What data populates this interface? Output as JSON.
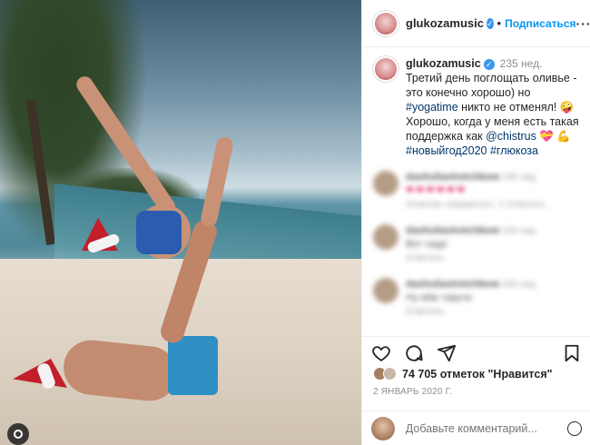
{
  "header": {
    "username": "glukozamusic",
    "separator": "•",
    "follow_label": "Подписаться",
    "more_label": "···"
  },
  "caption": {
    "username": "glukozamusic",
    "time": "235 нед.",
    "text_1": "Третий день поглощать оливье - это конечно хорошо) но ",
    "tag_yogatime": "#yogatime",
    "text_2": " никто не отменял! 🤪",
    "text_3": "Хорошо, когда у меня есть такая поддержка как ",
    "mention": "@chistrus",
    "text_4": " 💝 💪",
    "tag_newyear": "#новыйгод2020",
    "tag_glukoza": "#глюкоза"
  },
  "comments": [
    {
      "user": "dashuliastretchbow",
      "time": "235 нед.",
      "text": "❤❤❤❤❤❤",
      "sub": "Отметки «Нравится»: 1  Ответить"
    },
    {
      "user": "dashuliastretchbow",
      "time": "235 нед.",
      "text": "Вот надо",
      "sub": "Ответить"
    },
    {
      "user": "dashuliastretchbow",
      "time": "235 нед.",
      "text": "Ну вбм тавучо",
      "sub": "Ответить"
    }
  ],
  "likes": {
    "count_label": "74 705 отметок \"Нравится\""
  },
  "date": "2 ЯНВАРЬ 2020 Г.",
  "comment_input": {
    "placeholder": "Добавьте комментарий..."
  },
  "icons": [
    "heart-icon",
    "comment-icon",
    "share-icon",
    "bookmark-icon",
    "emoji-icon",
    "more-icon",
    "verified-icon"
  ]
}
